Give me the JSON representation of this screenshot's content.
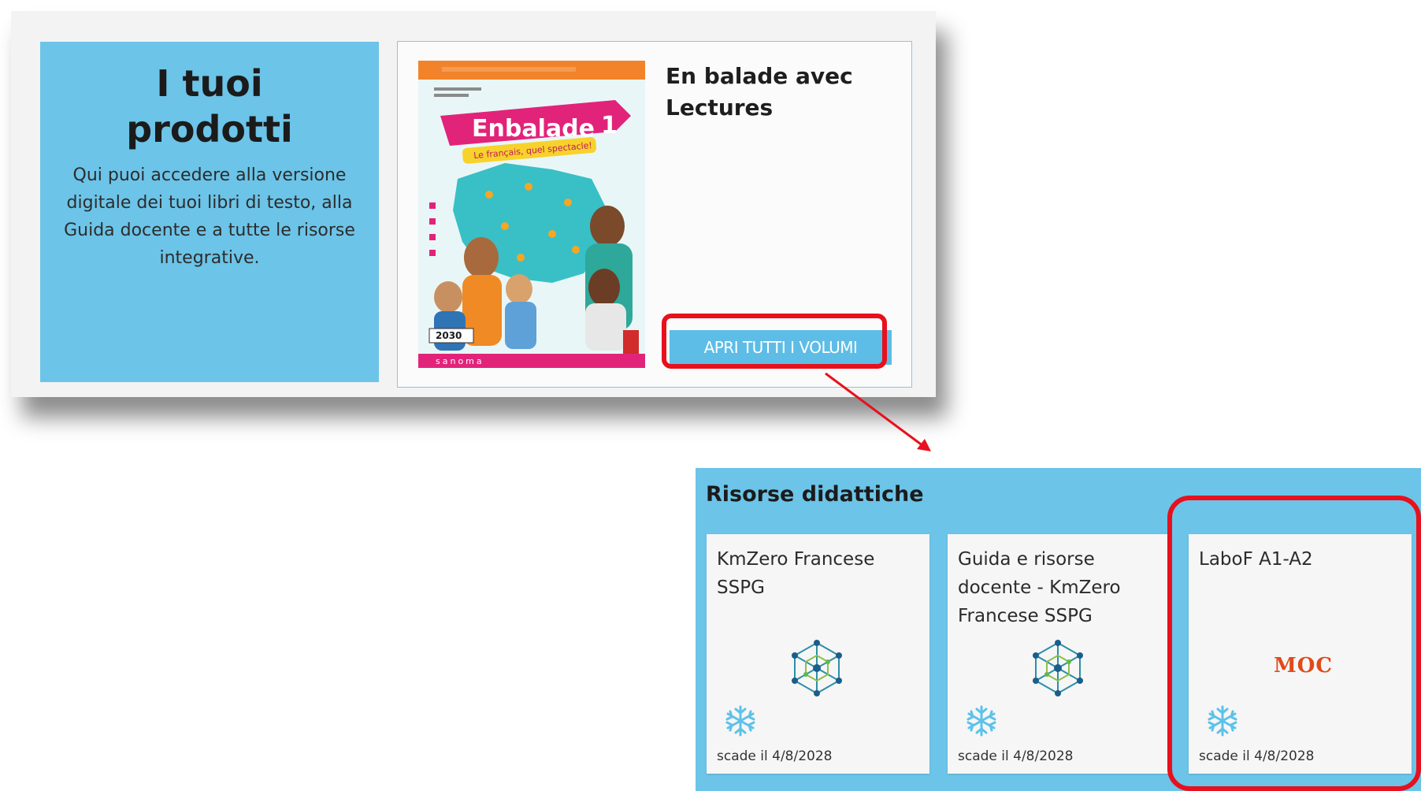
{
  "intro": {
    "title": "I tuoi prodotti",
    "description": "Qui puoi accedere alla versione digitale dei tuoi libri di testo, alla Guida docente e a tutte le risorse integrative."
  },
  "product": {
    "title": "En balade avec Lectures",
    "open_all_label": "APRI TUTTI I VOLUMI",
    "cover": {
      "series_title": "Enbalade",
      "volume": "1",
      "subtitle": "Le français, quel spectacle!",
      "badge": "2030",
      "publisher": "sanoma"
    }
  },
  "resources": {
    "title": "Risorse didattiche",
    "cards": [
      {
        "title": "KmZero Francese SSPG",
        "logo": "network-logo",
        "expiry": "scade il 4/8/2028"
      },
      {
        "title": "Guida e risorse docente - KmZero Francese SSPG",
        "logo": "network-logo",
        "expiry": "scade il 4/8/2028"
      },
      {
        "title": "LaboF A1-A2",
        "logo": "MOC",
        "expiry": "scade il 4/8/2028"
      }
    ]
  },
  "colors": {
    "panel_blue": "#6cc4e8",
    "button_blue": "#5dbde6",
    "highlight_red": "#e8101c"
  }
}
